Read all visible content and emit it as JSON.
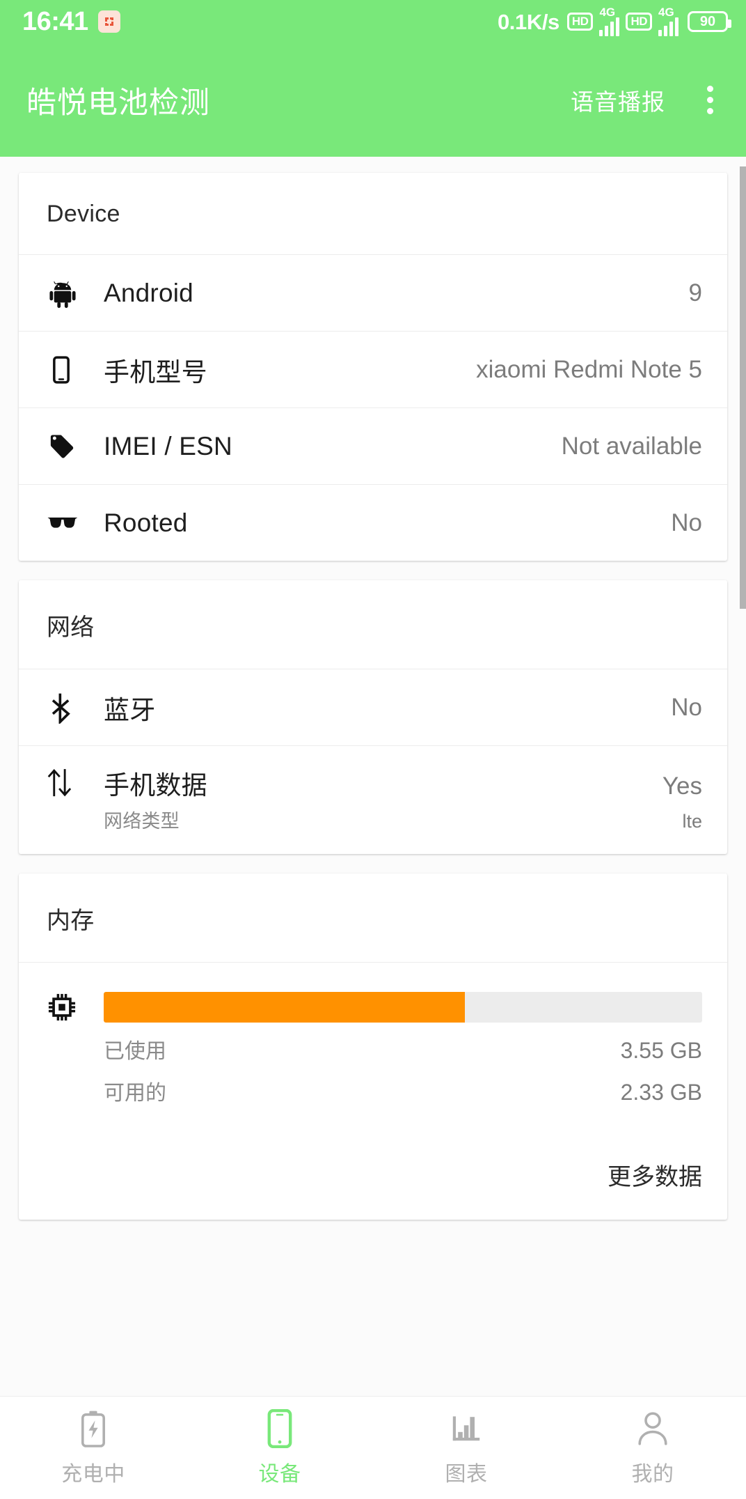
{
  "status_bar": {
    "clock": "16:41",
    "notification_icon": "app-notification-icon",
    "network_speed": "0.1K/s",
    "sim1": {
      "hd_badge": "HD",
      "network_label": "4G",
      "signal_bars": 4
    },
    "sim2": {
      "hd_badge": "HD",
      "network_label": "4G",
      "signal_bars": 4
    },
    "battery_percent": "90"
  },
  "app_bar": {
    "title": "皓悦电池检测",
    "action_label": "语音播报",
    "overflow_icon": "overflow-menu-icon"
  },
  "cards": [
    {
      "id": "device",
      "header": "Device",
      "rows": [
        {
          "icon": "android-robot-icon",
          "label": "Android",
          "value": "9"
        },
        {
          "icon": "smartphone-icon",
          "label": "手机型号",
          "value": "xiaomi Redmi Note 5"
        },
        {
          "icon": "tag-icon",
          "label": "IMEI / ESN",
          "value": "Not available"
        },
        {
          "icon": "sunglasses-icon",
          "label": "Rooted",
          "value": "No"
        }
      ]
    },
    {
      "id": "network",
      "header": "网络",
      "rows": [
        {
          "icon": "bluetooth-icon",
          "label": "蓝牙",
          "value": "No"
        }
      ],
      "data_row": {
        "icon": "data-transfer-icon",
        "label": "手机数据",
        "value": "Yes",
        "sub_label": "网络类型",
        "sub_value": "lte"
      }
    }
  ],
  "memory_card": {
    "header": "内存",
    "icon": "cpu-chip-icon",
    "used_percent": 60.4,
    "used_label": "已使用",
    "used_value": "3.55 GB",
    "free_label": "可用的",
    "free_value": "2.33 GB",
    "more_label": "更多数据",
    "bar_color": "#ff9100",
    "track_color": "#ececec"
  },
  "bottom_nav": {
    "active_color": "#79e87a",
    "inactive_color": "#b0b0b0",
    "items": [
      {
        "icon": "battery-charging-icon",
        "label": "充电中",
        "active": false
      },
      {
        "icon": "smartphone-icon",
        "label": "设备",
        "active": true
      },
      {
        "icon": "bar-chart-icon",
        "label": "图表",
        "active": false
      },
      {
        "icon": "person-icon",
        "label": "我的",
        "active": false
      }
    ]
  },
  "theme": {
    "primary_green": "#79e87a",
    "page_background": "#fbfbfb",
    "card_background": "#ffffff",
    "accent_orange": "#ff9100"
  }
}
